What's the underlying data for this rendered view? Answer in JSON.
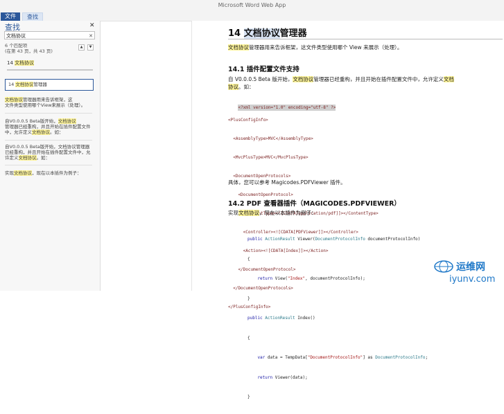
{
  "app_title": "Microsoft Word Web App",
  "tabs": {
    "file": "文件",
    "find": "查找"
  },
  "nav_pane": {
    "title": "查找",
    "search_value": "文档协议",
    "match_count_line1": "6 个匹配项",
    "match_count_line2": "(在第 43 页，共 43 页)",
    "heading_prefix": "14 ",
    "heading_hl": "文档协议",
    "results": [
      {
        "pre": "14 ",
        "hl": "文档协议",
        "post": "管理器"
      },
      {
        "line1_hl": "文档协议",
        "line1_post": "管理器用来告诉框架，这",
        "line2": "文件类型使用哪个View来展示（处理）。"
      },
      {
        "line1_pre": "自V0.0.0.5 Beta版开始，",
        "line1_hl": "文档协议",
        "line2": "管理器已经重构，并且开始在插件配置文件中，允许定义",
        "line2_hl": "文档协议",
        "line2_post": "。如："
      },
      {
        "line1": "自V0.0.0.5 Beta版开始，文档协议管理器已经重构，并且开始在插件配置文件中，允许定义",
        "line1_hl": "文档协议",
        "line1_post": "。如："
      },
      {
        "pre": "实现",
        "hl": "文档协议",
        "post": "，现在以本插件为例子："
      }
    ]
  },
  "doc": {
    "h1_num": "14  ",
    "h1_hl": "文档协议",
    "h1_post": "管理器",
    "p1_hl": "文档协议",
    "p1_post": "管理器用来告诉框架，这文件类型使用哪个 View 来展示（处理）。",
    "h2a": "14.1 插件配置文件支持",
    "p2_pre": "自 V0.0.0.5 Beta 版开始，",
    "p2_hl": "文档协议",
    "p2_mid": "管理器已经重构，并且开始在插件配置文件中，允许定义",
    "p2_hl2": "文档",
    "p2_line2_hl": "协议",
    "p2_line2_post": "。如：",
    "xml": [
      "<?xml version=\"1.0\" encoding=\"utf-8\" ?>",
      "<PlusConfigInfo>",
      "  <AssemblyType>MVC</AssemblyType>",
      "  <MvcPlusType>MVC</MvcPlusType>",
      "  <DocumentOpenProtocols>",
      "    <DocumentOpenProtocol>",
      "      <ContentType><![CDATA[application/pdf]]></ContentType>",
      "      <Controller><![CDATA[PDFViewer]]></Controller>",
      "      <Action><![CDATA[Index]]></Action>",
      "    </DocumentOpenProtocol>",
      "  </DocumentOpenProtocols>",
      "</PlusConfigInfo>"
    ],
    "p3": "具体，您可以参考 Magicodes.PDFViewer 插件。",
    "h2b": "14.2 PDF 查看器插件（MAGICODES.PDFVIEWER）",
    "p4_pre": "实现",
    "p4_hl": "文档协议",
    "p4_post": "，现在以本插件为例子：",
    "cs": [
      {
        "kw": "public ",
        "ty": "ActionResult",
        "rest": " Viewer(",
        "ty2": "DocumentProtocolInfo",
        "rest2": " documentProtocolInfo)"
      },
      {
        "plain": "{"
      },
      {
        "kw": "    return ",
        "rest": "View(",
        "str": "\"Index\"",
        "rest2": ", documentProtocolInfo);"
      },
      {
        "plain": "}"
      },
      {
        "kw": "public ",
        "ty": "ActionResult",
        "rest": " Index()"
      },
      {
        "plain": "{"
      },
      {
        "kw": "    var ",
        "rest": "data = TempData[",
        "str": "\"DocumentProtocolInfo\"",
        "rest2": "] as ",
        "ty2": "DocumentProtocolInfo",
        "rest3": ";"
      },
      {
        "kw": "    return ",
        "rest": "Viewer(data);"
      },
      {
        "plain": "}"
      }
    ]
  },
  "watermark": {
    "cn": "运维网",
    "en": "iyunv.com"
  },
  "colors": {
    "accent": "#2b579a",
    "highlight": "#fff59a",
    "watermark": "#1f78c8"
  }
}
